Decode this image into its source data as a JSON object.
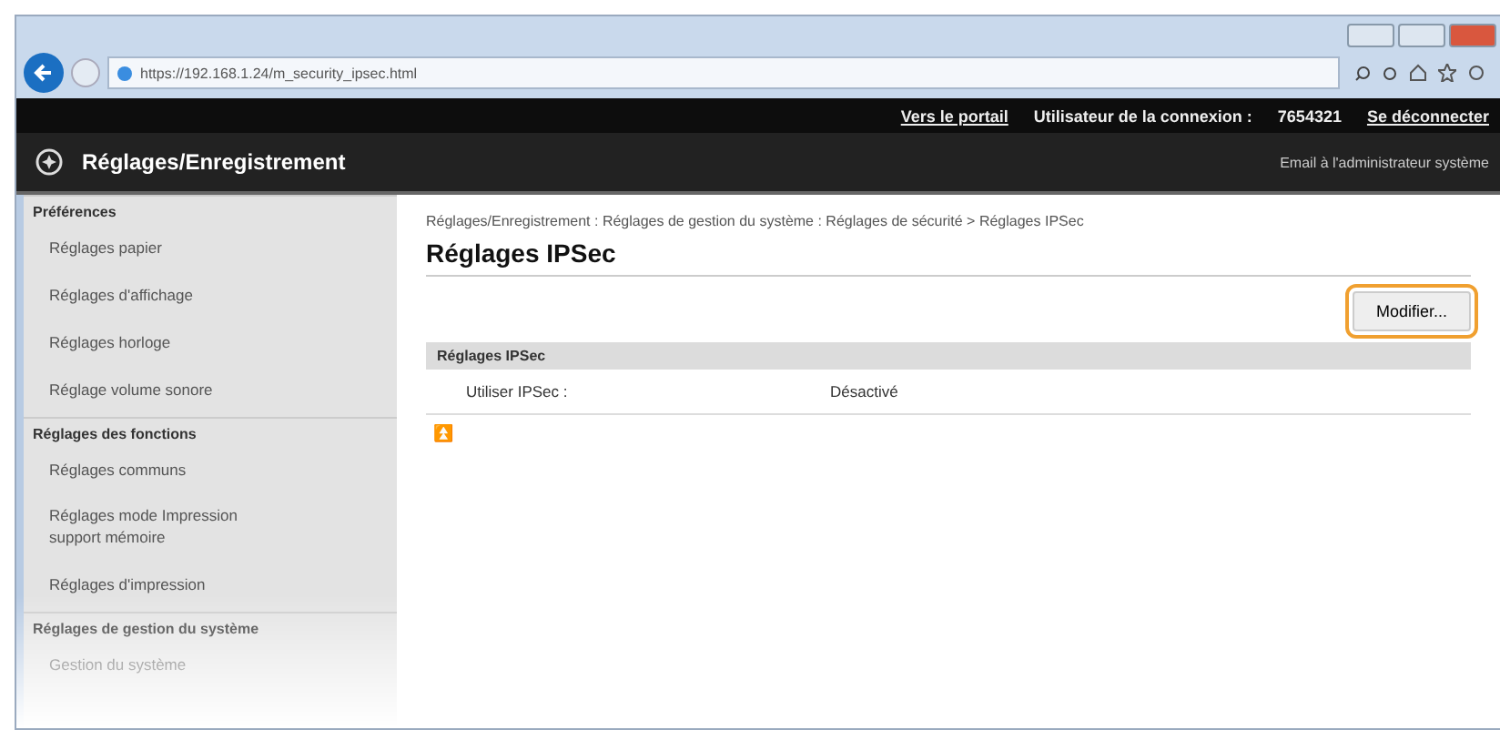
{
  "browser": {
    "url": "https://192.168.1.24/m_security_ipsec.html"
  },
  "topbar": {
    "links": [
      "Vers le portail",
      "Se déconnecter"
    ],
    "user_label": "Utilisateur de la connexion :",
    "user_id": "7654321"
  },
  "header": {
    "title": "Réglages/Enregistrement",
    "admin_link": "Email à l'administrateur système"
  },
  "sidebar": {
    "sections": [
      {
        "title": "Préférences",
        "items": [
          "Réglages papier",
          "Réglages d'affichage",
          "Réglages horloge",
          "Réglage volume sonore"
        ]
      },
      {
        "title": "Réglages des fonctions",
        "items": [
          "Réglages communs",
          "Réglages mode Impression support mémoire",
          "Réglages d'impression"
        ]
      },
      {
        "title": "Réglages de gestion du système",
        "items": [
          "Gestion du système"
        ]
      }
    ]
  },
  "content": {
    "breadcrumb": "Réglages/Enregistrement : Réglages de gestion du système : Réglages de sécurité > Réglages IPSec",
    "title": "Réglages IPSec",
    "button": "Modifier...",
    "section": "Réglages IPSec",
    "rows": [
      {
        "label": "Utiliser IPSec :",
        "value": "Désactivé"
      }
    ],
    "top_mark": "⏫"
  }
}
